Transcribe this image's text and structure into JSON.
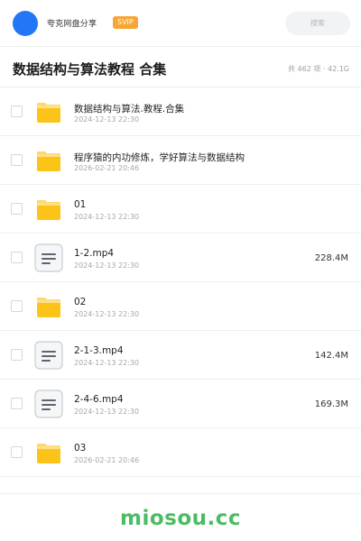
{
  "header": {
    "app_name": "夸克网盘分享",
    "badge": "SVIP",
    "search_label": "搜索"
  },
  "folder": {
    "title": "数据结构与算法教程 合集",
    "meta": "共 462 项 · 42.1G"
  },
  "items": [
    {
      "type": "folder",
      "name": "数据结构与算法.教程.合集",
      "date": "2024-12-13 22:30",
      "size": ""
    },
    {
      "type": "folder",
      "name": "程序猿的内功修炼，学好算法与数据结构",
      "date": "2026-02-21 20:46",
      "size": ""
    },
    {
      "type": "folder",
      "name": "01",
      "date": "2024-12-13 22:30",
      "size": ""
    },
    {
      "type": "file",
      "name": "1-2.mp4",
      "date": "2024-12-13 22:30",
      "size": "228.4M"
    },
    {
      "type": "folder",
      "name": "02",
      "date": "2024-12-13 22:30",
      "size": ""
    },
    {
      "type": "file",
      "name": "2-1-3.mp4",
      "date": "2024-12-13 22:30",
      "size": "142.4M"
    },
    {
      "type": "file",
      "name": "2-4-6.mp4",
      "date": "2024-12-13 22:30",
      "size": "169.3M"
    },
    {
      "type": "folder",
      "name": "03",
      "date": "2026-02-21 20:46",
      "size": ""
    }
  ],
  "footer": {
    "watermark": "miosou.cc"
  },
  "colors": {
    "avatar": "#2377f6",
    "badge": "#f7a534",
    "folder": "#fcc419",
    "watermark": "#4cbc64"
  }
}
